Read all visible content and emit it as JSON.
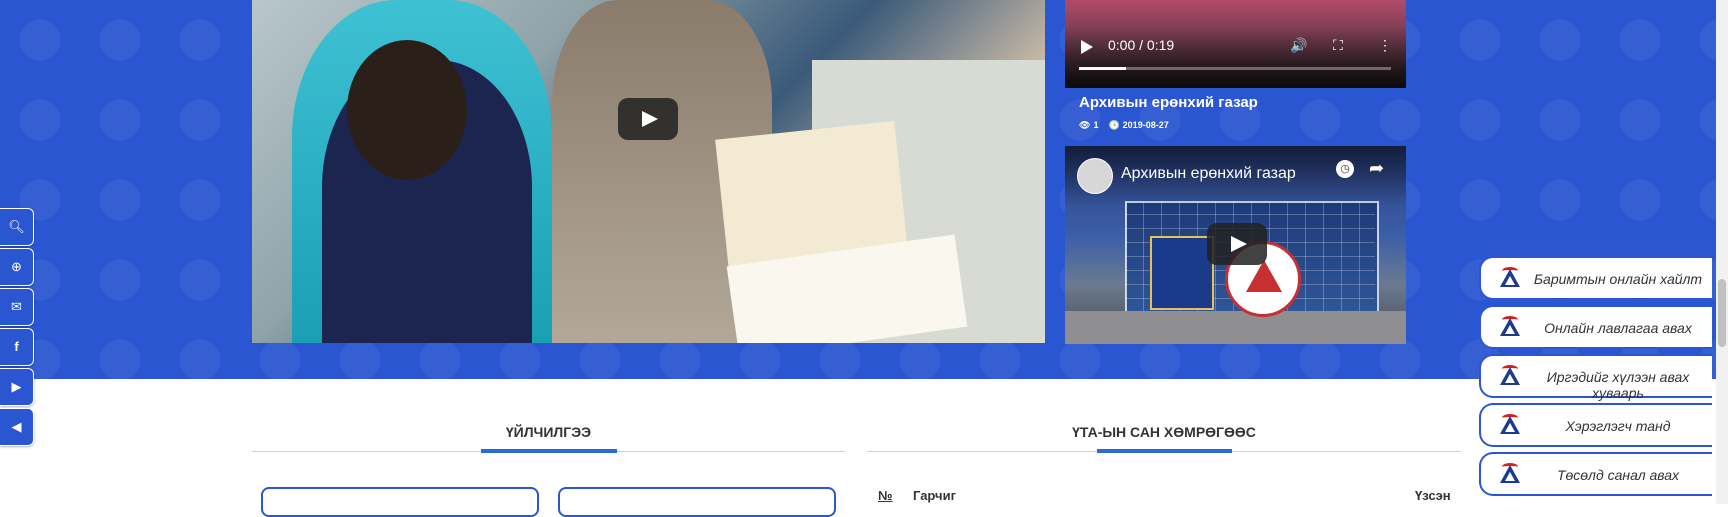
{
  "main_video": {
    "label": "Main video player"
  },
  "side_videos": [
    {
      "time": "0:00 / 0:19",
      "progress": 0.15,
      "title": "Архивын ерөнхий газар",
      "views": "1",
      "date": "2019-08-27"
    },
    {
      "channel_title": "Архивын ерөнхий газар"
    }
  ],
  "left_toolbar": {
    "items": [
      {
        "icon": "search-icon",
        "glyph": "🔍"
      },
      {
        "icon": "zoom-in-icon",
        "glyph": "⊕"
      },
      {
        "icon": "envelope-icon",
        "glyph": "✉"
      },
      {
        "icon": "facebook-icon",
        "glyph": "f"
      },
      {
        "icon": "youtube-icon",
        "glyph": "▶"
      },
      {
        "icon": "megaphone-icon",
        "glyph": "◀"
      }
    ]
  },
  "right_panel": {
    "items": [
      {
        "label": "Баримтын онлайн хайлт"
      },
      {
        "label": "Онлайн лавлагаа авах"
      },
      {
        "label": "Иргэдийг хүлээн авах хуваарь"
      },
      {
        "label": "Хэрэглэгч танд"
      },
      {
        "label": "Төсөлд санал авах"
      }
    ]
  },
  "sections": {
    "services_title": "ҮЙЛЧИЛГЭЭ",
    "fund_title": "ҮТА-ЫН САН ХӨМРӨГӨӨС"
  },
  "table": {
    "col_no": "№",
    "col_title": "Гарчиг",
    "col_views": "Үзсэн"
  },
  "colors": {
    "primary": "#2a56d1",
    "accent": "#2a6bd8"
  }
}
